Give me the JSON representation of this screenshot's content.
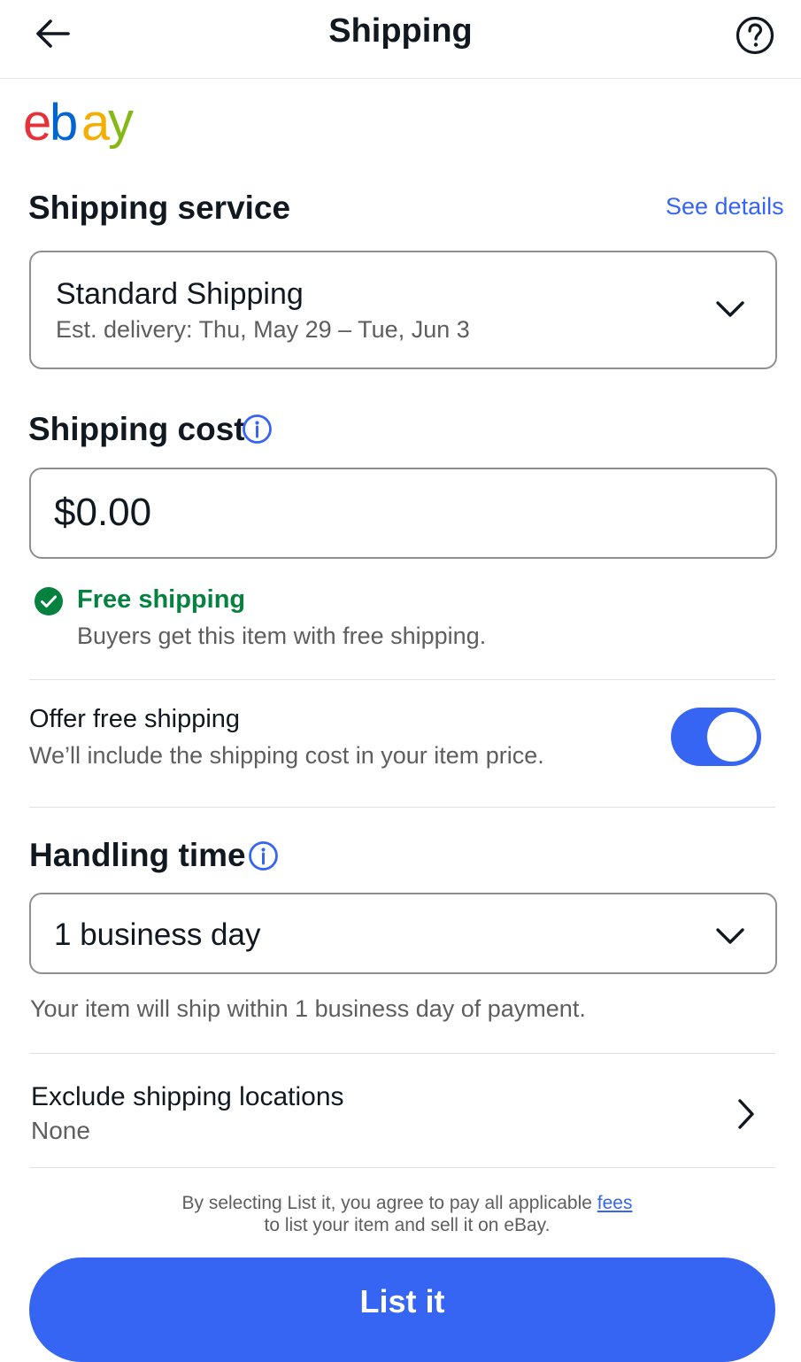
{
  "header": {
    "title": "Shipping",
    "back_icon": "arrow-left-icon",
    "help_icon": "question-circle-icon"
  },
  "brand": {
    "logo_text": "ebay",
    "letter_colors": [
      "#e53238",
      "#0064d2",
      "#f5af02",
      "#86b817"
    ]
  },
  "shipping_service": {
    "heading": "Shipping service",
    "see_details": "See details",
    "selected": "Standard Shipping",
    "est_delivery": "Est. delivery: Thu, May 29 – Tue, Jun 3"
  },
  "shipping_cost": {
    "heading": "Shipping cost",
    "currency": "$",
    "value": "0.00",
    "status_title": "Free shipping",
    "status_text": "Buyers get this item with free shipping."
  },
  "offer_free_shipping": {
    "title": "Offer free shipping",
    "description": "We’ll include the shipping cost in your item price.",
    "enabled": true
  },
  "handling_time": {
    "heading": "Handling time",
    "selected": "1 business day",
    "note": "Your item will ship within 1 business day of payment."
  },
  "exclude_locations": {
    "title": "Exclude shipping locations",
    "value": "None"
  },
  "footer": {
    "terms_prefix": "By selecting List it, you agree to pay all applicable ",
    "terms_link": "fees",
    "terms_suffix": "to list your item and sell it on eBay.",
    "list_button": "List it"
  },
  "colors": {
    "accent": "#3665f3",
    "success": "#05823f",
    "text": "#111820",
    "secondary_text": "#5e5e5e"
  }
}
